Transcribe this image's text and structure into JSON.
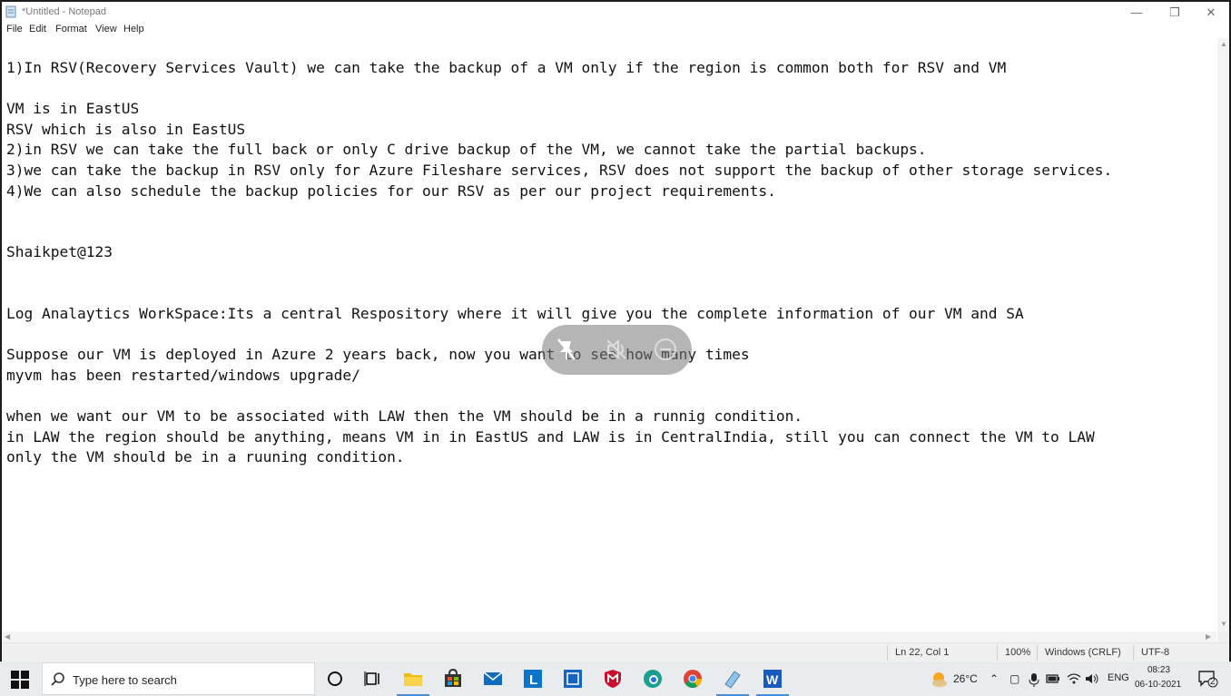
{
  "window": {
    "title": "*Untitled - Notepad",
    "minimize": "—",
    "maximize": "❐",
    "close": "✕"
  },
  "menu": [
    "File",
    "Edit",
    "Format",
    "View",
    "Help"
  ],
  "editor": {
    "lines": [
      "1)In RSV(Recovery Services Vault) we can take the backup of a VM only if the region is common both for RSV and VM",
      "",
      "VM is in EastUS",
      "RSV which is also in EastUS",
      "2)in RSV we can take the full back or only C drive backup of the VM, we cannot take the partial backups.",
      "3)we can take the backup in RSV only for Azure Fileshare services, RSV does not support the backup of other storage services.",
      "4)We can also schedule the backup policies for our RSV as per our project requirements.",
      "",
      "",
      "Shaikpet@123",
      "",
      "",
      "Log Analaytics WorkSpace:Its a central Respository where it will give you the complete information of our VM and SA",
      "",
      "Suppose our VM is deployed in Azure 2 years back, now you want to see how many times",
      "myvm has been restarted/windows upgrade/",
      "",
      "when we want our VM to be associated with LAW then the VM should be in a runnig condition.",
      "in LAW the region should be anything, means VM in in EastUS and LAW is in CentralIndia, still you can connect the VM to LAW",
      "only the VM should be in a ruuning condition."
    ]
  },
  "status": {
    "position": "Ln 22, Col 1",
    "zoom": "100%",
    "line_ending": "Windows (CRLF)",
    "encoding": "UTF-8"
  },
  "taskbar": {
    "search_placeholder": "Type here to search",
    "temperature": "26°C",
    "language": "ENG",
    "time": "08:23",
    "date": "06-10-2021",
    "notifications": "2"
  }
}
